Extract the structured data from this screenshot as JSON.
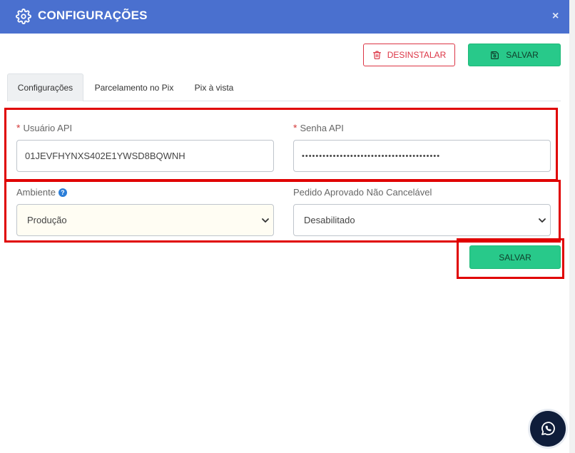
{
  "header": {
    "title": "CONFIGURAÇÕES",
    "gear_icon": "gear-icon",
    "close_label": "×",
    "background": "#4a70cf"
  },
  "toolbar": {
    "uninstall_label": "DESINSTALAR",
    "uninstall_icon": "trash-icon",
    "save_label": "SALVAR",
    "save_icon": "save-icon"
  },
  "tabs": [
    {
      "label": "Configurações",
      "active": true
    },
    {
      "label": "Parcelamento no Pix",
      "active": false
    },
    {
      "label": "Pix à vista",
      "active": false
    }
  ],
  "form": {
    "usuario_api": {
      "required": "*",
      "label": "Usuário API",
      "value": "01JEVFHYNXS402E1YWSD8BQWNH"
    },
    "senha_api": {
      "required": "*",
      "label": "Senha API",
      "value": "••••••••••••••••••••••••••••••••••••••••"
    },
    "ambiente": {
      "label": "Ambiente",
      "help_icon": "question-circle-icon",
      "help_glyph": "?",
      "selected": "Produção"
    },
    "pedido_aprovado": {
      "label": "Pedido Aprovado Não Cancelável",
      "selected": "Desabilitado"
    }
  },
  "footer": {
    "save_label": "SALVAR"
  },
  "chat": {
    "icon": "whatsapp-icon"
  },
  "colors": {
    "accent_green": "#28c98a",
    "danger_red": "#dc3545",
    "highlight_red": "#e00000"
  }
}
